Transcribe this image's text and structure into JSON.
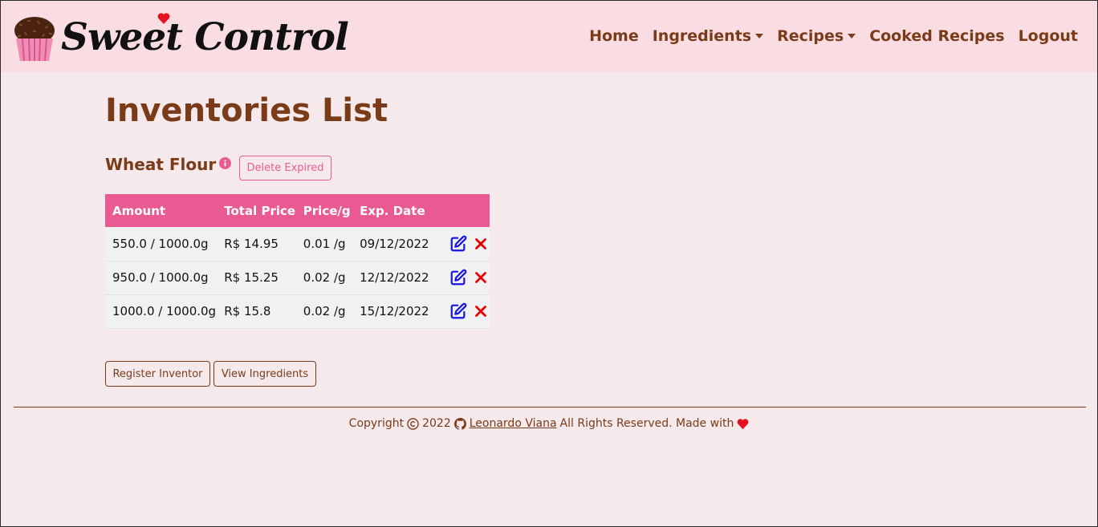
{
  "brand": {
    "name": "Sweet Control"
  },
  "nav": {
    "home": "Home",
    "ingredients": "Ingredients",
    "recipes": "Recipes",
    "cooked_recipes": "Cooked Recipes",
    "logout": "Logout"
  },
  "page": {
    "title": "Inventories List",
    "ingredient_name": "Wheat Flour",
    "delete_expired": "Delete Expired"
  },
  "table": {
    "headers": [
      "Amount",
      "Total Price",
      "Price/g",
      "Exp. Date"
    ],
    "rows": [
      {
        "amount": "550.0 / 1000.0g",
        "total_price": "R$ 14.95",
        "price_per_g": "0.01 /g",
        "exp_date": "09/12/2022"
      },
      {
        "amount": "950.0 / 1000.0g",
        "total_price": "R$ 15.25",
        "price_per_g": "0.02 /g",
        "exp_date": "12/12/2022"
      },
      {
        "amount": "1000.0 / 1000.0g",
        "total_price": "R$ 15.8",
        "price_per_g": "0.02 /g",
        "exp_date": "15/12/2022"
      }
    ]
  },
  "buttons": {
    "register_inventory": "Register Inventor",
    "view_ingredients": "View Ingredients"
  },
  "footer": {
    "copyright": "Copyright",
    "year": "2022",
    "author": "Leonardo Viana",
    "rights": "All Rights Reserved. Made with"
  },
  "icons": {
    "cupcake": "cupcake-logo-icon",
    "info": "info-circle-icon",
    "edit": "edit-icon",
    "delete": "x-icon",
    "copyright": "copyright-icon",
    "github": "github-icon",
    "heart": "heart-icon"
  },
  "colors": {
    "navbar_bg": "#f9dde2",
    "page_bg": "#f5e9eb",
    "brown": "#7a3b19",
    "pink": "#ea5a92",
    "edit_blue": "#1414e6",
    "delete_red": "#e60000",
    "heart_red": "#e8101c"
  }
}
